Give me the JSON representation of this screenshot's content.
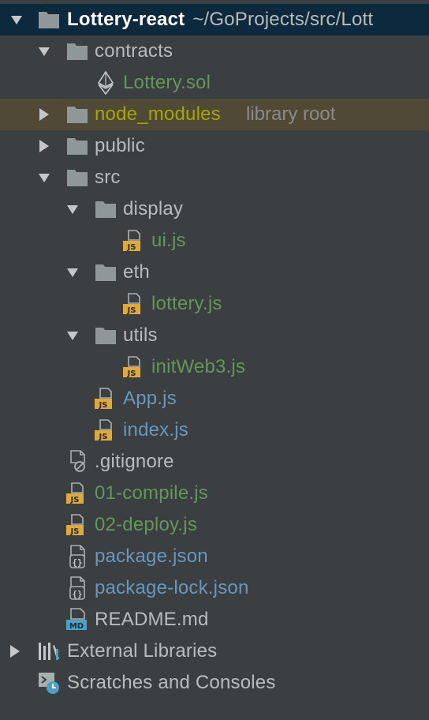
{
  "tree": {
    "root": {
      "name": "Lottery-react",
      "path": "~/GoProjects/src/Lott",
      "icon": "folder-icon"
    },
    "items": [
      {
        "label": "contracts",
        "type": "folder",
        "level": 1,
        "expanded": true,
        "color": "#bbbbbb",
        "icon": "folder-icon"
      },
      {
        "label": "Lottery.sol",
        "type": "file",
        "level": 2,
        "color": "#629755",
        "icon": "ethereum-icon"
      },
      {
        "label": "node_modules",
        "hint": "library root",
        "type": "folder",
        "level": 1,
        "expanded": false,
        "color": "#a6a600",
        "icon": "folder-icon",
        "library": true
      },
      {
        "label": "public",
        "type": "folder",
        "level": 1,
        "expanded": false,
        "color": "#bbbbbb",
        "icon": "folder-icon"
      },
      {
        "label": "src",
        "type": "folder",
        "level": 1,
        "expanded": true,
        "color": "#bbbbbb",
        "icon": "folder-icon"
      },
      {
        "label": "display",
        "type": "folder",
        "level": 2,
        "expanded": true,
        "color": "#bbbbbb",
        "icon": "folder-icon"
      },
      {
        "label": "ui.js",
        "type": "file",
        "level": 3,
        "color": "#629755",
        "icon": "js-file-icon"
      },
      {
        "label": "eth",
        "type": "folder",
        "level": 2,
        "expanded": true,
        "color": "#bbbbbb",
        "icon": "folder-icon"
      },
      {
        "label": "lottery.js",
        "type": "file",
        "level": 3,
        "color": "#629755",
        "icon": "js-file-icon"
      },
      {
        "label": "utils",
        "type": "folder",
        "level": 2,
        "expanded": true,
        "color": "#bbbbbb",
        "icon": "folder-icon"
      },
      {
        "label": "initWeb3.js",
        "type": "file",
        "level": 3,
        "color": "#629755",
        "icon": "js-file-icon"
      },
      {
        "label": "App.js",
        "type": "file",
        "level": 2,
        "color": "#6897bb",
        "icon": "js-file-icon"
      },
      {
        "label": "index.js",
        "type": "file",
        "level": 2,
        "color": "#6897bb",
        "icon": "js-file-icon"
      },
      {
        "label": ".gitignore",
        "type": "file",
        "level": 1,
        "color": "#bbbbbb",
        "icon": "ignored-file-icon"
      },
      {
        "label": "01-compile.js",
        "type": "file",
        "level": 1,
        "color": "#629755",
        "icon": "js-file-icon"
      },
      {
        "label": "02-deploy.js",
        "type": "file",
        "level": 1,
        "color": "#629755",
        "icon": "js-file-icon"
      },
      {
        "label": "package.json",
        "type": "file",
        "level": 1,
        "color": "#6897bb",
        "icon": "json-file-icon"
      },
      {
        "label": "package-lock.json",
        "type": "file",
        "level": 1,
        "color": "#6897bb",
        "icon": "json-file-icon"
      },
      {
        "label": "README.md",
        "type": "file",
        "level": 1,
        "color": "#bbbbbb",
        "icon": "markdown-file-icon"
      },
      {
        "label": "External Libraries",
        "type": "special",
        "level": 0,
        "expanded": false,
        "color": "#bbbbbb",
        "icon": "external-libraries-icon"
      },
      {
        "label": "Scratches and Consoles",
        "type": "special",
        "level": 0,
        "color": "#bbbbbb",
        "icon": "scratches-icon"
      }
    ]
  },
  "colors": {
    "background": "#3c3f41",
    "selected_row": "#0d293e",
    "library_row": "#4f4935",
    "folder_icon": "#8f9799",
    "js_badge": "#e0a93b"
  }
}
